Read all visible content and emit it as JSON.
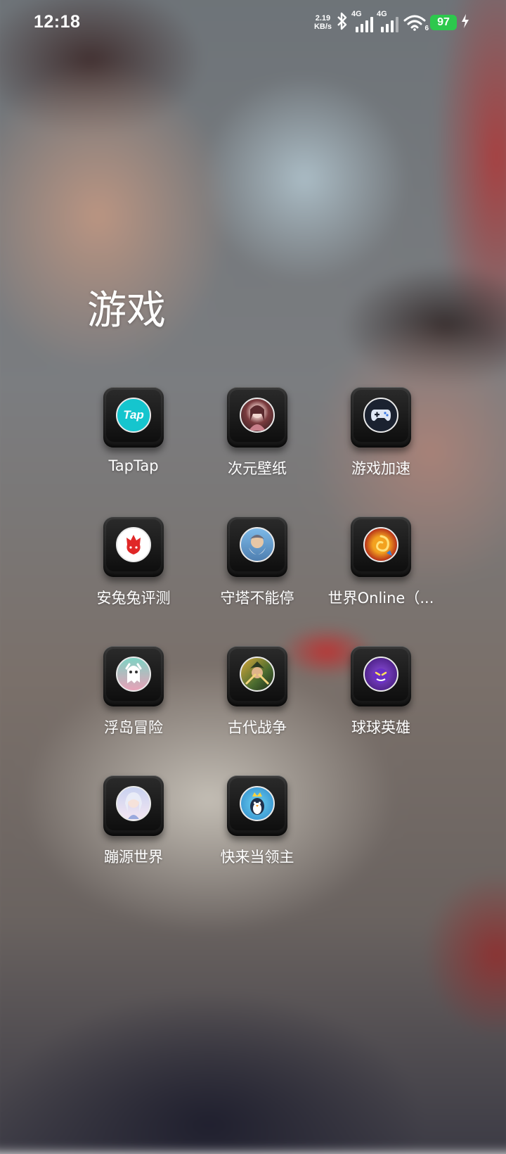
{
  "status_bar": {
    "time": "12:18",
    "net_speed_value": "2.19",
    "net_speed_unit": "KB/s",
    "signal1_tag": "4G",
    "signal2_tag": "4G",
    "wifi_tag": "6",
    "battery_level": "97",
    "battery_color": "#2dc84d"
  },
  "folder": {
    "title": "游戏",
    "apps": [
      {
        "label": "TapTap",
        "icon": "taptap-icon",
        "icon_text": "Tap"
      },
      {
        "label": "次元壁纸",
        "icon": "anime-girl-wallpaper-icon"
      },
      {
        "label": "游戏加速",
        "icon": "gamepad-icon"
      },
      {
        "label": "安兔兔评测",
        "icon": "antutu-flame-icon"
      },
      {
        "label": "守塔不能停",
        "icon": "wizard-avatar-icon"
      },
      {
        "label": "世界Online（...",
        "icon": "swirl-emblem-icon"
      },
      {
        "label": "浮岛冒险",
        "icon": "ghost-character-icon"
      },
      {
        "label": "古代战争",
        "icon": "warrior-avatar-icon"
      },
      {
        "label": "球球英雄",
        "icon": "purple-monster-icon"
      },
      {
        "label": "蹦源世界",
        "icon": "anime-character-icon"
      },
      {
        "label": "快来当领主",
        "icon": "penguin-king-icon"
      }
    ]
  }
}
